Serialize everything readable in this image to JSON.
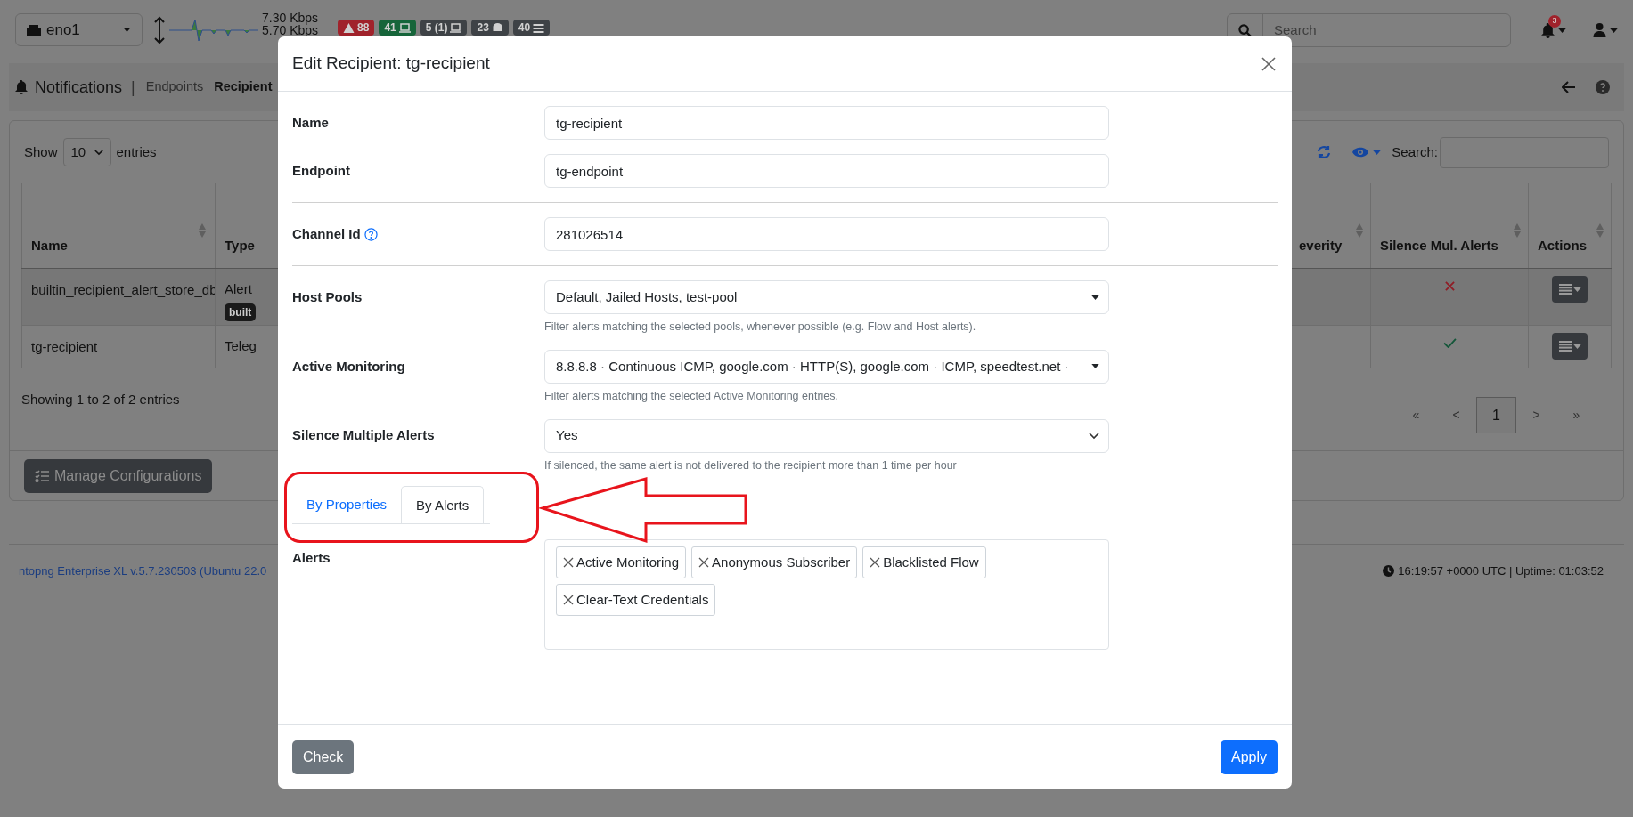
{
  "navbar": {
    "interface": "eno1",
    "upload": "7.30 Kbps",
    "download": "5.70 Kbps",
    "badges": [
      {
        "kind": "alert",
        "text": "88"
      },
      {
        "kind": "flows",
        "text": "41"
      },
      {
        "kind": "hosts",
        "text": "5 (1)"
      },
      {
        "kind": "devices",
        "text": "23"
      },
      {
        "kind": "list",
        "text": "40"
      }
    ],
    "search": {
      "placeholder": "Search"
    },
    "notifications": "3"
  },
  "breadcrumb": {
    "title": "Notifications",
    "separator": "|",
    "items": [
      {
        "label": "Endpoints",
        "selected": false
      },
      {
        "label": "Recipient",
        "selected": true
      }
    ]
  },
  "table": {
    "show_label": "Show",
    "length": "10",
    "entries_label": "entries",
    "search_label": "Search:",
    "left_columns": [
      "Name",
      "Type"
    ],
    "right_columns": [
      "everity",
      "Silence Mul. Alerts",
      "Actions"
    ],
    "rows": [
      {
        "name": "builtin_recipient_alert_store_db",
        "type": "Alert",
        "tag": "built",
        "silence": false
      },
      {
        "name": "tg-recipient",
        "type": "Teleg",
        "silence": true
      }
    ],
    "info": "Showing 1 to 2 of 2 entries",
    "pagination": [
      {
        "label": "«",
        "selected": false
      },
      {
        "label": "<",
        "selected": false
      },
      {
        "label": "1",
        "selected": true
      },
      {
        "label": ">",
        "selected": false
      },
      {
        "label": "»",
        "selected": false
      }
    ]
  },
  "manage_button": "Manage Configurations",
  "footer": {
    "version": "ntopng Enterprise XL v.5.7.230503 (Ubuntu 22.0",
    "clock": "16:19:57 +0000 UTC | Uptime: 01:03:52"
  },
  "modal": {
    "title": "Edit Recipient: tg-recipient",
    "sections": [
      {
        "fields": [
          {
            "kind": "text",
            "label": "Name",
            "value": "tg-recipient"
          },
          {
            "kind": "text",
            "label": "Endpoint",
            "value": "tg-endpoint"
          }
        ]
      },
      {
        "fields": [
          {
            "kind": "text",
            "label": "Channel Id",
            "value": "281026514",
            "help": true
          }
        ]
      },
      {
        "fields": [
          {
            "kind": "multiselect",
            "label": "Host Pools",
            "value": "Default, Jailed Hosts, test-pool",
            "hint": "Filter alerts matching the selected pools, whenever possible (e.g. Flow and Host alerts)."
          },
          {
            "kind": "multiselect",
            "label": "Active Monitoring",
            "value": "8.8.8.8 · Continuous ICMP, google.com · HTTP(S), google.com · ICMP, speedtest.net ·",
            "hint": "Filter alerts matching the selected Active Monitoring entries."
          },
          {
            "kind": "select",
            "label": "Silence Multiple Alerts",
            "value": "Yes",
            "hint": "If silenced, the same alert is not delivered to the recipient more than 1 time per hour"
          }
        ]
      }
    ],
    "tabs": [
      {
        "label": "By Properties",
        "selected": false
      },
      {
        "label": "By Alerts",
        "selected": true
      }
    ],
    "alerts": {
      "label": "Alerts",
      "tags": [
        "Active Monitoring",
        "Anonymous Subscriber",
        "Blacklisted Flow",
        "Clear-Text Credentials"
      ]
    },
    "check_button": "Check",
    "apply_button": "Apply"
  }
}
